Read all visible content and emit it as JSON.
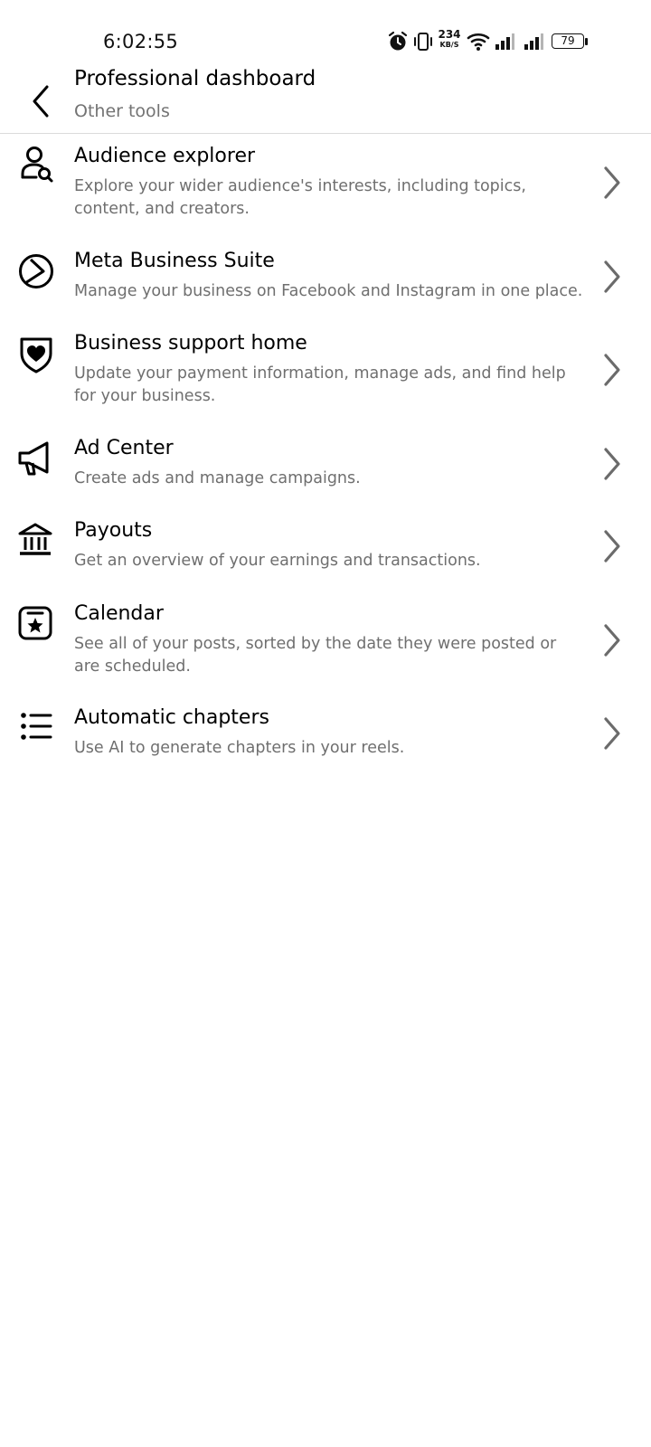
{
  "status_bar": {
    "time": "6:02:55",
    "net_speed_value": "234",
    "net_speed_unit": "KB/S",
    "battery": "79",
    "icons": [
      "alarm-icon",
      "vibrate-icon",
      "wifi-icon",
      "signal-icon",
      "signal-icon",
      "battery-icon"
    ]
  },
  "header": {
    "title": "Professional dashboard",
    "subtitle": "Other tools",
    "back_icon": "back-arrow-icon"
  },
  "tools": [
    {
      "title": "Audience explorer",
      "description": "Explore your wider audience's interests, including topics, content, and creators.",
      "icon": "person-search-icon"
    },
    {
      "title": "Meta Business Suite",
      "description": "Manage your business on Facebook and Instagram in one place.",
      "icon": "meta-business-suite-icon"
    },
    {
      "title": "Business support home",
      "description": "Update your payment information, manage ads, and find help for your business.",
      "icon": "shield-heart-icon"
    },
    {
      "title": "Ad Center",
      "description": "Create ads and manage campaigns.",
      "icon": "megaphone-icon"
    },
    {
      "title": "Payouts",
      "description": "Get an overview of your earnings and transactions.",
      "icon": "bank-icon"
    },
    {
      "title": "Calendar",
      "description": "See all of your posts, sorted by the date they were posted or are scheduled.",
      "icon": "calendar-star-icon"
    },
    {
      "title": "Automatic chapters",
      "description": "Use AI to generate chapters in your reels.",
      "icon": "list-icon"
    }
  ],
  "colors": {
    "primary_text": "#000000",
    "secondary_text": "#737373",
    "chevron": "#6b6b6b",
    "divider": "#dbdbdb",
    "background": "#ffffff"
  }
}
